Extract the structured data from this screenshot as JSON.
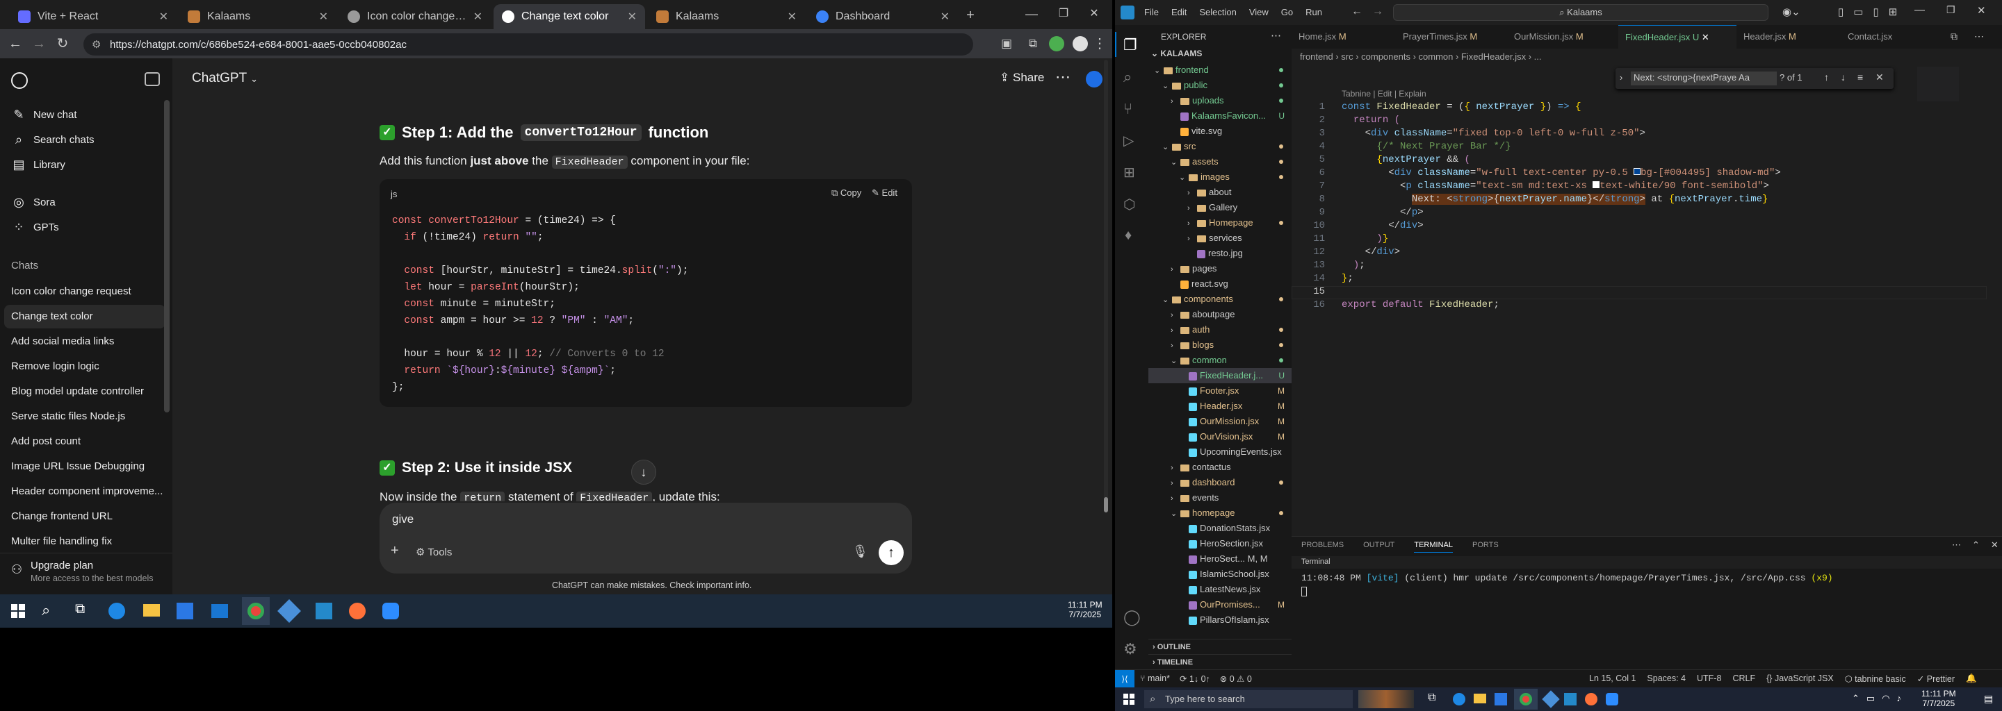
{
  "chrome": {
    "tabs": [
      {
        "title": "Vite + React",
        "color": "#646cff",
        "active": false
      },
      {
        "title": "Kalaams",
        "color": "#c27b3a",
        "active": false
      },
      {
        "title": "Icon color change request",
        "color": "#9a9a9a",
        "active": false
      },
      {
        "title": "Change text color",
        "color": "#9a9a9a",
        "active": true
      },
      {
        "title": "Kalaams",
        "color": "#c27b3a",
        "active": false
      },
      {
        "title": "Dashboard",
        "color": "#3b82f6",
        "active": false
      }
    ],
    "new_tab": "+",
    "url": "https://chatgpt.com/c/686be524-e684-8001-aae5-0ccb040802ac"
  },
  "gpt": {
    "sidebar": {
      "items": [
        {
          "label": "New chat",
          "icon": "compose-icon"
        },
        {
          "label": "Search chats",
          "icon": "search-icon"
        },
        {
          "label": "Library",
          "icon": "library-icon"
        },
        {
          "label": "Sora",
          "icon": "sora-icon"
        },
        {
          "label": "GPTs",
          "icon": "gpts-icon"
        }
      ],
      "chats_header": "Chats",
      "chats": [
        "Icon color change request",
        "Change text color",
        "Add social media links",
        "Remove login logic",
        "Blog model update controller",
        "Serve static files Node.js",
        "Add post count",
        "Image URL Issue Debugging",
        "Header component improveme...",
        "Change frontend URL",
        "Multer file handling fix"
      ],
      "active_chat": 1,
      "upgrade_title": "Upgrade plan",
      "upgrade_sub": "More access to the best models"
    },
    "header": {
      "model": "ChatGPT",
      "share": "Share"
    },
    "step1": {
      "check": "✅",
      "prefix": "Step 1: Add the",
      "code": "convertTo12Hour",
      "suffix": "function",
      "para_a": "Add this function",
      "para_b": "just above",
      "para_c": "the",
      "para_code": "FixedHeader",
      "para_d": "component in your file:"
    },
    "codeblock": {
      "lang": "js",
      "copy": "Copy",
      "edit": "Edit"
    },
    "step2": {
      "check": "✅",
      "title": "Step 2: Use it inside JSX"
    },
    "step2_para": {
      "a": "Now inside the",
      "code1": "return",
      "b": "statement of",
      "code2": "FixedHeader",
      "c": ", update this:"
    },
    "composer": {
      "value": "give",
      "tools": "Tools"
    },
    "disclaimer": "ChatGPT can make mistakes. Check important info."
  },
  "taskbar_left": {
    "time": "11:11 PM",
    "date": "7/7/2025"
  },
  "vscode": {
    "menu": [
      "File",
      "Edit",
      "Selection",
      "View",
      "Go",
      "Run"
    ],
    "search": "Kalaams",
    "explorer_title": "EXPLORER",
    "workspace": "KALAAMS",
    "tabs": [
      {
        "label": "Home.jsx",
        "badge": "M",
        "active": false
      },
      {
        "label": "PrayerTimes.jsx",
        "badge": "M",
        "active": false
      },
      {
        "label": "OurMission.jsx",
        "badge": "M",
        "active": false
      },
      {
        "label": "FixedHeader.jsx",
        "badge": "U",
        "active": true
      },
      {
        "label": "Header.jsx",
        "badge": "M",
        "active": false
      },
      {
        "label": "Contact.jsx",
        "badge": "",
        "active": false
      }
    ],
    "breadcrumb": "frontend › src › components › common › FixedHeader.jsx › ...",
    "find": {
      "query": "Next: <strong>{nextPraye Aa",
      "count": "? of 1"
    },
    "codelens": "Tabnine | Edit | Explain",
    "tree": [
      {
        "label": "frontend",
        "depth": 0,
        "kind": "folder-open",
        "status": "dot-green"
      },
      {
        "label": "public",
        "depth": 1,
        "kind": "folder-open",
        "status": "dot-green"
      },
      {
        "label": "uploads",
        "depth": 2,
        "kind": "folder",
        "status": "dot-green"
      },
      {
        "label": "KalaamsFavicon...",
        "depth": 2,
        "kind": "file",
        "status": "U"
      },
      {
        "label": "vite.svg",
        "depth": 2,
        "kind": "file",
        "status": ""
      },
      {
        "label": "src",
        "depth": 1,
        "kind": "folder-open",
        "status": "dot-yellow"
      },
      {
        "label": "assets",
        "depth": 2,
        "kind": "folder-open",
        "status": "dot-yellow"
      },
      {
        "label": "images",
        "depth": 3,
        "kind": "folder-open",
        "status": "dot-yellow"
      },
      {
        "label": "about",
        "depth": 4,
        "kind": "folder",
        "status": ""
      },
      {
        "label": "Gallery",
        "depth": 4,
        "kind": "folder",
        "status": ""
      },
      {
        "label": "Homepage",
        "depth": 4,
        "kind": "folder",
        "status": "dot-yellow"
      },
      {
        "label": "services",
        "depth": 4,
        "kind": "folder",
        "status": ""
      },
      {
        "label": "resto.jpg",
        "depth": 4,
        "kind": "file",
        "status": ""
      },
      {
        "label": "pages",
        "depth": 2,
        "kind": "folder",
        "status": ""
      },
      {
        "label": "react.svg",
        "depth": 2,
        "kind": "file",
        "status": ""
      },
      {
        "label": "components",
        "depth": 1,
        "kind": "folder-open",
        "status": "dot-yellow"
      },
      {
        "label": "aboutpage",
        "depth": 2,
        "kind": "folder",
        "status": ""
      },
      {
        "label": "auth",
        "depth": 2,
        "kind": "folder",
        "status": "dot-yellow"
      },
      {
        "label": "blogs",
        "depth": 2,
        "kind": "folder",
        "status": "dot-yellow"
      },
      {
        "label": "common",
        "depth": 2,
        "kind": "folder-open",
        "status": "dot-green"
      },
      {
        "label": "FixedHeader.j...",
        "depth": 3,
        "kind": "file",
        "status": "U",
        "selected": true
      },
      {
        "label": "Footer.jsx",
        "depth": 3,
        "kind": "file",
        "status": "M"
      },
      {
        "label": "Header.jsx",
        "depth": 3,
        "kind": "file",
        "status": "M"
      },
      {
        "label": "OurMission.jsx",
        "depth": 3,
        "kind": "file",
        "status": "M"
      },
      {
        "label": "OurVision.jsx",
        "depth": 3,
        "kind": "file",
        "status": "M"
      },
      {
        "label": "UpcomingEvents.jsx",
        "depth": 3,
        "kind": "file",
        "status": ""
      },
      {
        "label": "contactus",
        "depth": 2,
        "kind": "folder",
        "status": ""
      },
      {
        "label": "dashboard",
        "depth": 2,
        "kind": "folder",
        "status": "dot-yellow"
      },
      {
        "label": "events",
        "depth": 2,
        "kind": "folder",
        "status": ""
      },
      {
        "label": "homepage",
        "depth": 2,
        "kind": "folder-open",
        "status": "dot-yellow"
      },
      {
        "label": "DonationStats.jsx",
        "depth": 3,
        "kind": "file",
        "status": ""
      },
      {
        "label": "HeroSection.jsx",
        "depth": 3,
        "kind": "file",
        "status": ""
      },
      {
        "label": "HeroSect... M, M",
        "depth": 3,
        "kind": "file",
        "status": ""
      },
      {
        "label": "IslamicSchool.jsx",
        "depth": 3,
        "kind": "file",
        "status": ""
      },
      {
        "label": "LatestNews.jsx",
        "depth": 3,
        "kind": "file",
        "status": ""
      },
      {
        "label": "OurPromises...",
        "depth": 3,
        "kind": "file",
        "status": "M"
      },
      {
        "label": "PillarsOfIslam.jsx",
        "depth": 3,
        "kind": "file",
        "status": ""
      }
    ],
    "outline": "OUTLINE",
    "timeline": "TIMELINE",
    "panel": {
      "tabs": [
        "PROBLEMS",
        "OUTPUT",
        "TERMINAL",
        "PORTS"
      ],
      "active": 2,
      "subheader": "Terminal",
      "log_time": "11:08:48 PM",
      "log_vite": "[vite]",
      "log_rest": "(client) hmr update /src/components/homepage/PrayerTimes.jsx, /src/App.css",
      "log_count": "(x9)"
    },
    "status": {
      "branch": "main*",
      "sync": "⟳ 1↓ 0↑",
      "errors": "⊗ 0 ⚠ 0",
      "position": "Ln 15, Col 1",
      "spaces": "Spaces: 4",
      "encoding": "UTF-8",
      "eol": "CRLF",
      "lang": "JavaScript JSX",
      "tabnine": "tabnine basic",
      "prettier": "✓ Prettier"
    }
  },
  "taskbar_right": {
    "search": "Type here to search",
    "time": "11:11 PM",
    "date": "7/7/2025"
  }
}
